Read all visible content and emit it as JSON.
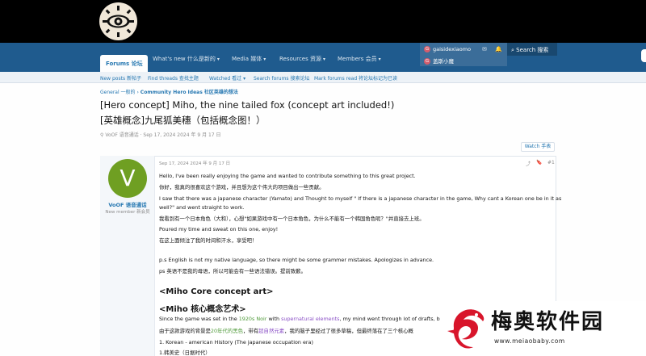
{
  "header": {
    "logo_icon": "eye-emblem-icon"
  },
  "nav": {
    "forums": "Forums  论坛",
    "whats_new": "What's new  什么是新的",
    "media": "Media  媒体",
    "resources": "Resources  资源",
    "members": "Members  会员",
    "user1": "gaisidexiaomo",
    "user2": "盖斯小魔",
    "avatar_letter": "G",
    "search": "Search  搜索"
  },
  "subnav": {
    "new_posts": "New posts  新帖子",
    "find_threads": "Find threads  查找主题",
    "watched": "Watched  看过",
    "search_forums": "Search forums  搜索论坛",
    "mark_read": "Mark forums read  将论坛标记为已读"
  },
  "breadcrumb": {
    "general": "General  一般的",
    "community": "Community Hero Ideas  社区英雄的想法"
  },
  "thread": {
    "title_en": "[Hero concept] Miho, the nine tailed fox (concept art included!)",
    "title_zh": "[英雄概念]九尾狐美穗（包括概念图！）",
    "meta": "VoOF  语音通话 · Sep 17, 2024  2024 年 9 月 17 日",
    "watch": "Watch  手表"
  },
  "post": {
    "avatar_letter": "V",
    "username": "VoOF  语音通话",
    "role": "New member  新会员",
    "date": "Sep 17, 2024  2024 年 9 月 17 日",
    "number": "#1",
    "lines": {
      "l1": "Hello, I've been really enjoying the game and wanted to contribute something to this great project.",
      "l2": "你好，我真的很喜欢这个游戏，并且想为这个伟大的项目做出一些贡献。",
      "l3": "I saw that there was a japanese character (Yamato) and Thought to myself \" If there is a japanese character in the game, Why cant a Korean one be in it as",
      "l4": "well?\" and went straight to work.",
      "l5": "我看到有一个日本角色（大和），心想\"如果游戏中有一个日本角色，为什么不能有一个韩国角色呢？\"并直接去上班。",
      "l6": "Poured my time and sweat on this one, enjoy!",
      "l7": "在这上面倾注了我的时间和汗水，享受吧！",
      "l8": "p.s English is not my native language, so there might be some grammer mistakes. Apologizes in advance.",
      "l9": "ps 英语不是我的母语，所以可能会有一些语法错误。提前致歉。",
      "h1": "<Miho Core concept art>",
      "h2": "<Miho 核心概念艺术>",
      "l10a": "Since the game was set in the ",
      "l10b": "1920s Noir",
      "l10c": " with ",
      "l10d": "supernatural elements",
      "l10e": ", my mind went through lot of drafts, but u",
      "l11a": "由于这款游戏的背景是",
      "l11b": "20年代的黑色",
      "l11c": "，带有",
      "l11d": "超自然元素",
      "l11e": "，我的脑子里经过了很多草稿，但最终落在了三个核心概",
      "l12": "1. Korean - american History (The japanese occupation era)",
      "l13": "1.韩美史（日据时代）"
    }
  },
  "watermark": {
    "text": "梅奥软件园",
    "url": "www.meiaobaby.com"
  },
  "colors": {
    "nav_blue": "#1f5b8e",
    "link_blue": "#2577b1",
    "avatar_green": "#6f9f22",
    "highlight_green": "#4f9a3a",
    "highlight_purple": "#8a4fc6"
  }
}
